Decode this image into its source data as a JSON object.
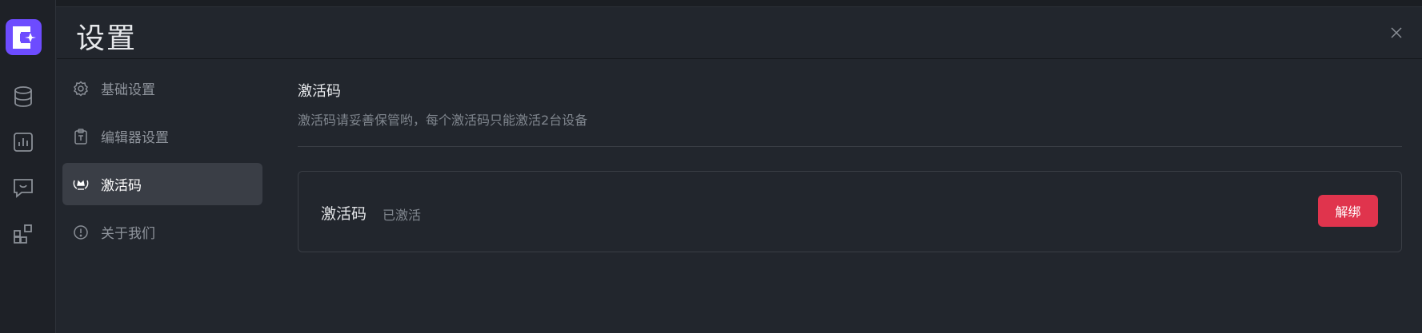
{
  "header": {
    "title": "设置"
  },
  "rail": {
    "items": [
      {
        "icon": "database-icon"
      },
      {
        "icon": "chart-icon"
      },
      {
        "icon": "chat-icon"
      },
      {
        "icon": "apps-icon"
      }
    ]
  },
  "menu": {
    "items": [
      {
        "label": "基础设置",
        "icon": "gear-icon",
        "active": false
      },
      {
        "label": "编辑器设置",
        "icon": "clipboard-text-icon",
        "active": false
      },
      {
        "label": "激活码",
        "icon": "crown-laurel-icon",
        "active": true
      },
      {
        "label": "关于我们",
        "icon": "info-circle-icon",
        "active": false
      }
    ]
  },
  "main": {
    "title": "激活码",
    "description": "激活码请妥善保管哟，每个激活码只能激活2台设备",
    "card": {
      "label": "激活码",
      "status": "已激活",
      "button": "解绑"
    }
  },
  "colors": {
    "accent": "#6d4cff",
    "danger": "#e0344d",
    "background": "#22262d"
  }
}
